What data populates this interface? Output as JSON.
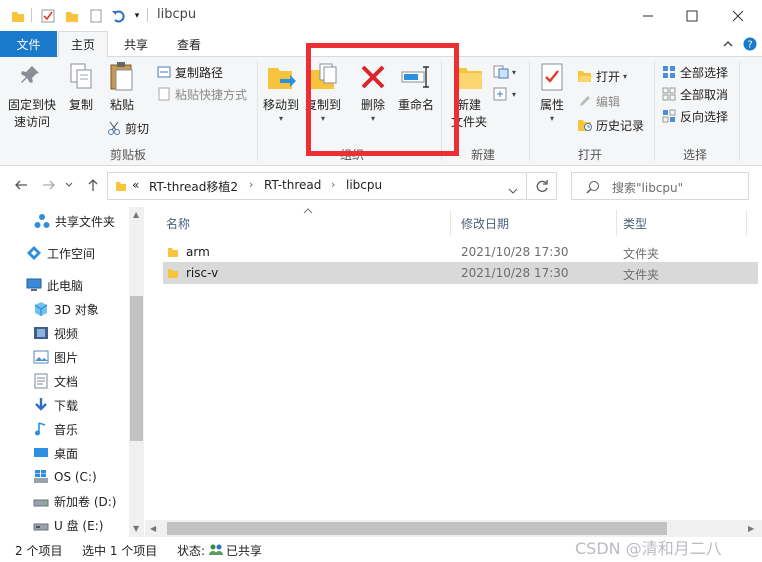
{
  "window": {
    "title": "libcpu"
  },
  "ribbon_tabs": [
    "文件",
    "主页",
    "共享",
    "查看"
  ],
  "clipboard": {
    "pin_label_1": "固定到快",
    "pin_label_2": "速访问",
    "copy_label": "复制",
    "paste_label": "粘贴",
    "copy_path_label": "复制路径",
    "paste_shortcut_label": "粘贴快捷方式",
    "cut_label": "剪切",
    "group_label": "剪贴板"
  },
  "organize": {
    "move_to_label": "移动到",
    "copy_to_label": "复制到",
    "delete_label": "删除",
    "rename_label": "重命名",
    "group_label": "组织"
  },
  "new_group": {
    "new_folder_label_1": "新建",
    "new_folder_label_2": "文件夹",
    "group_label": "新建"
  },
  "open_group": {
    "properties_label": "属性",
    "open_label": "打开",
    "edit_label": "编辑",
    "history_label": "历史记录",
    "group_label": "打开"
  },
  "select_group": {
    "select_all_label": "全部选择",
    "select_none_label": "全部取消",
    "invert_label": "反向选择",
    "group_label": "选择"
  },
  "address": {
    "overflow": "«",
    "crumbs": [
      "RT-thread移植2",
      "RT-thread",
      "libcpu"
    ],
    "search_placeholder": "搜索\"libcpu\""
  },
  "nav": {
    "quick_access": "共享文件夹",
    "workspace": "工作空间",
    "this_pc": "此电脑",
    "items": [
      "3D 对象",
      "视频",
      "图片",
      "文档",
      "下载",
      "音乐",
      "桌面",
      "OS (C:)",
      "新加卷 (D:)",
      "U 盘 (E:)"
    ]
  },
  "columns": {
    "name": "名称",
    "modified": "修改日期",
    "type": "类型"
  },
  "files": [
    {
      "name": "arm",
      "modified": "2021/10/28 17:30",
      "type": "文件夹"
    },
    {
      "name": "risc-v",
      "modified": "2021/10/28 17:30",
      "type": "文件夹"
    }
  ],
  "status": {
    "count": "2 个项目",
    "selected": "选中 1 个项目",
    "state_label": "状态:",
    "state_value": "已共享"
  },
  "watermark": "CSDN @清和月二八",
  "colors": {
    "accent": "#1979ca",
    "highlight_box": "#ec2e35",
    "folder": "#f8c43d"
  }
}
